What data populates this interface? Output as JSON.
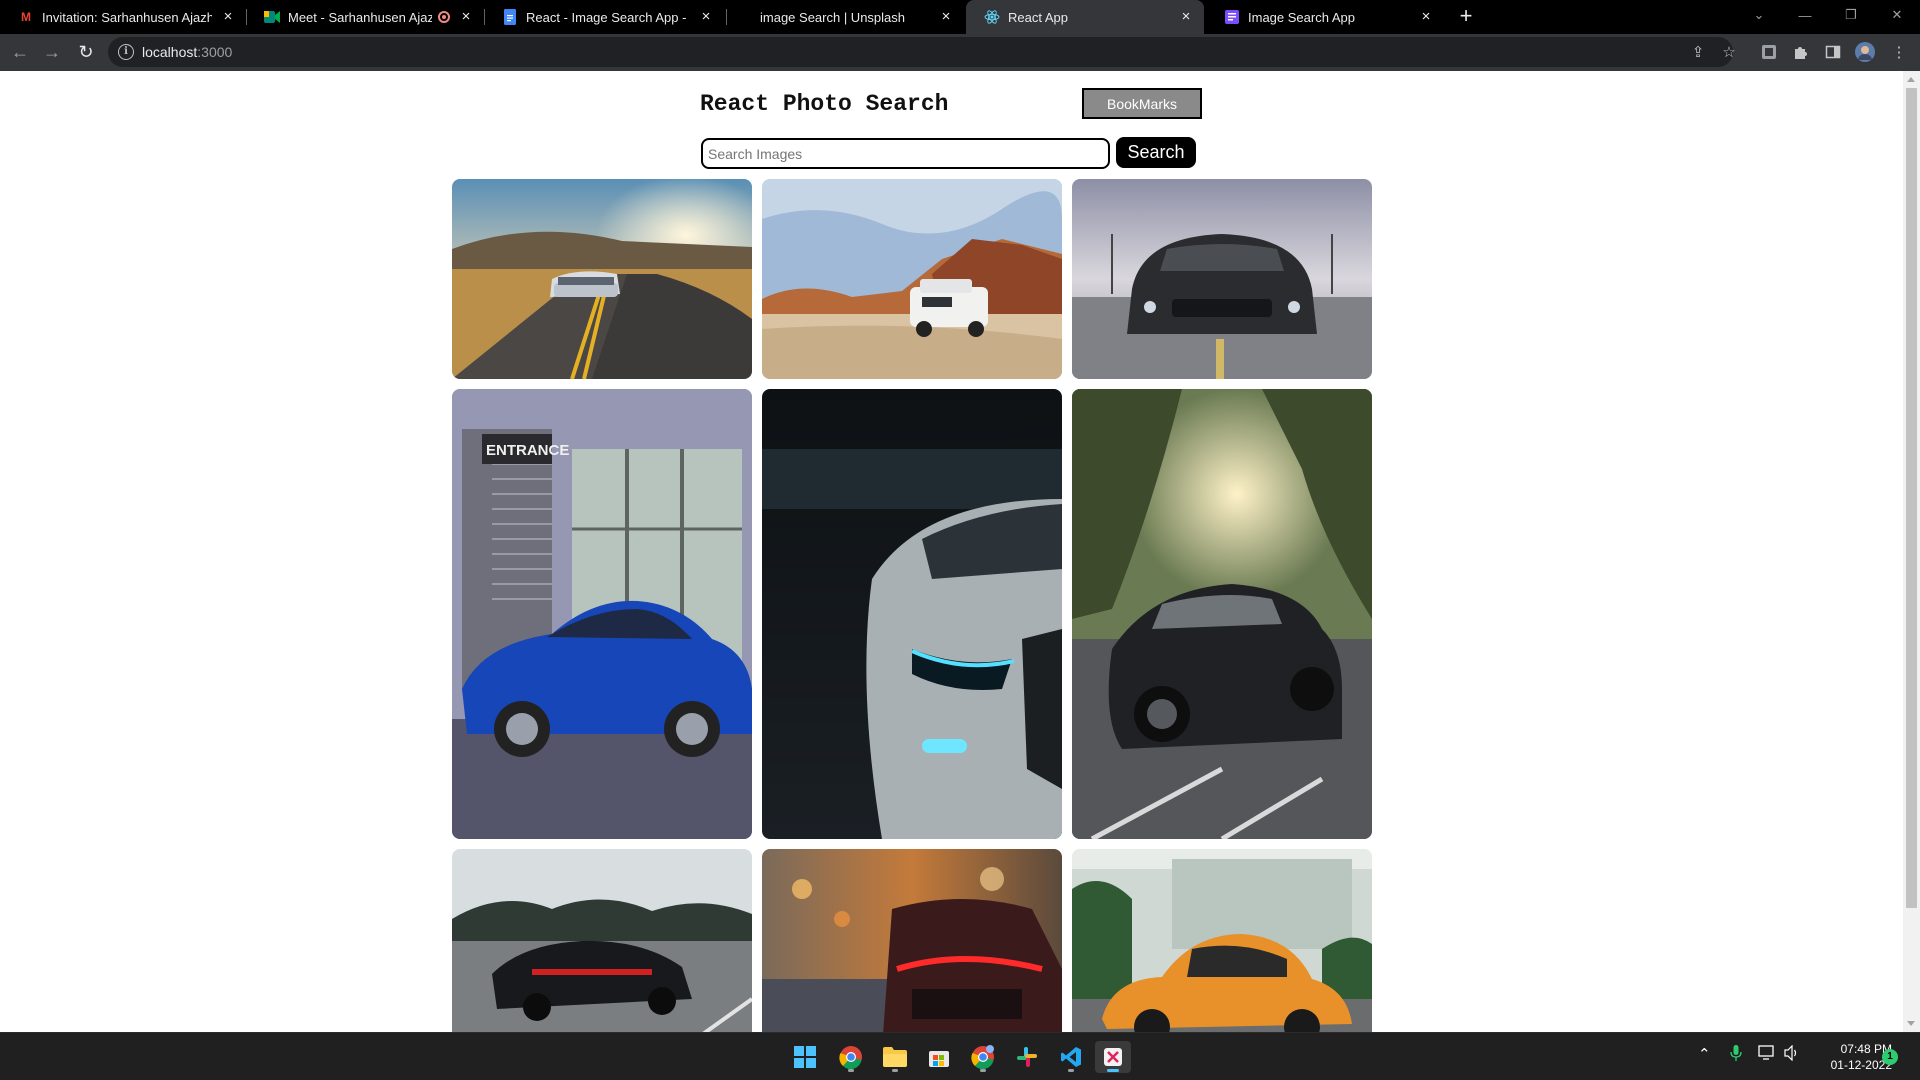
{
  "browser": {
    "tabs": [
      {
        "title": "Invitation: Sarhanhusen Ajazhuse",
        "favicon": "gmail-icon",
        "color": "#ea4335"
      },
      {
        "title": "Meet - Sarhanhusen Ajazhus",
        "favicon": "google-meet-icon",
        "color": "#00897b"
      },
      {
        "title": "React - Image Search App - Goo",
        "favicon": "google-docs-icon",
        "color": "#4285f4"
      },
      {
        "title": "image Search | Unsplash",
        "favicon": "unsplash-icon",
        "color": "#ffffff"
      },
      {
        "title": "React App",
        "favicon": "react-icon",
        "color": "#61dafb"
      },
      {
        "title": "Image Search App",
        "favicon": "app-icon",
        "color": "#7c4dff"
      }
    ],
    "active_tab": 4,
    "url_host": "localhost",
    "url_port": ":3000"
  },
  "page": {
    "title": "React Photo Search",
    "bookmarks_label": "BookMarks",
    "search": {
      "placeholder": "Search Images",
      "value": "",
      "button_label": "Search"
    },
    "photos": [
      {
        "subject": "white sports car on winding road at sunset"
      },
      {
        "subject": "white SUV on desert road"
      },
      {
        "subject": "black muscle car front view"
      },
      {
        "subject": "blue coupe by building entrance",
        "sign": "ENTRANCE"
      },
      {
        "subject": "silver car headlight in dark garage"
      },
      {
        "subject": "black muscle car in parking lot"
      },
      {
        "subject": "black sedan on highway"
      },
      {
        "subject": "red sports car rear on city street"
      },
      {
        "subject": "orange vintage beetle"
      }
    ]
  },
  "taskbar": {
    "apps": [
      "start-icon",
      "chrome-icon",
      "file-explorer-icon",
      "store-icon",
      "chrome-profile-icon",
      "slack-icon",
      "vscode-icon",
      "snipping-tool-icon"
    ],
    "time": "07:48 PM",
    "date": "01-12-2022",
    "notifications": "1"
  }
}
